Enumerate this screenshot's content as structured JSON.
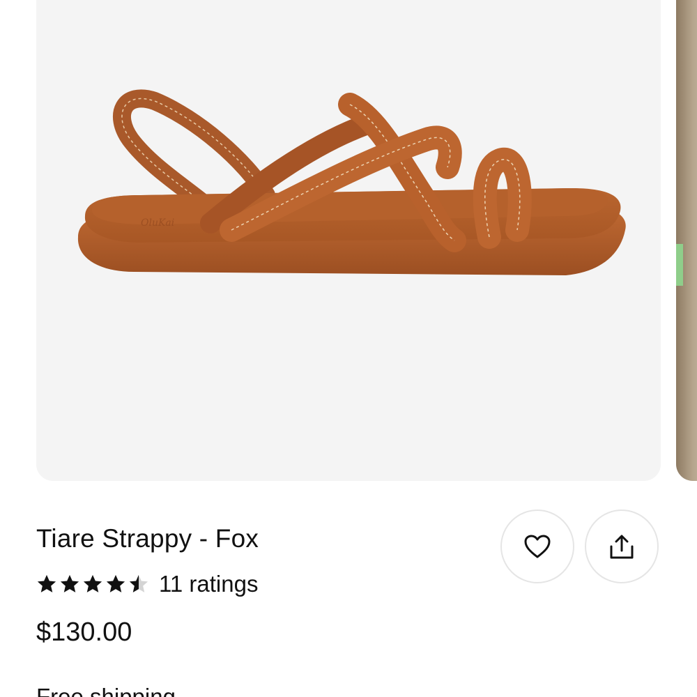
{
  "product": {
    "title": "Tiare Strappy - Fox",
    "rating_value": 4.5,
    "rating_max": 5,
    "ratings_label": "11 ratings",
    "price": "$130.00",
    "shipping": "Free shipping"
  },
  "image": {
    "alt": "Tiare Strappy - Fox",
    "brand_mark": "OluKai"
  },
  "actions": {
    "favorite_icon": "heart-outline-icon",
    "share_icon": "share-upload-icon"
  },
  "colors": {
    "text": "#111111",
    "card_background": "#f4f4f4",
    "sandal_leather": "#b8612c",
    "button_border": "#e5e5e5"
  }
}
